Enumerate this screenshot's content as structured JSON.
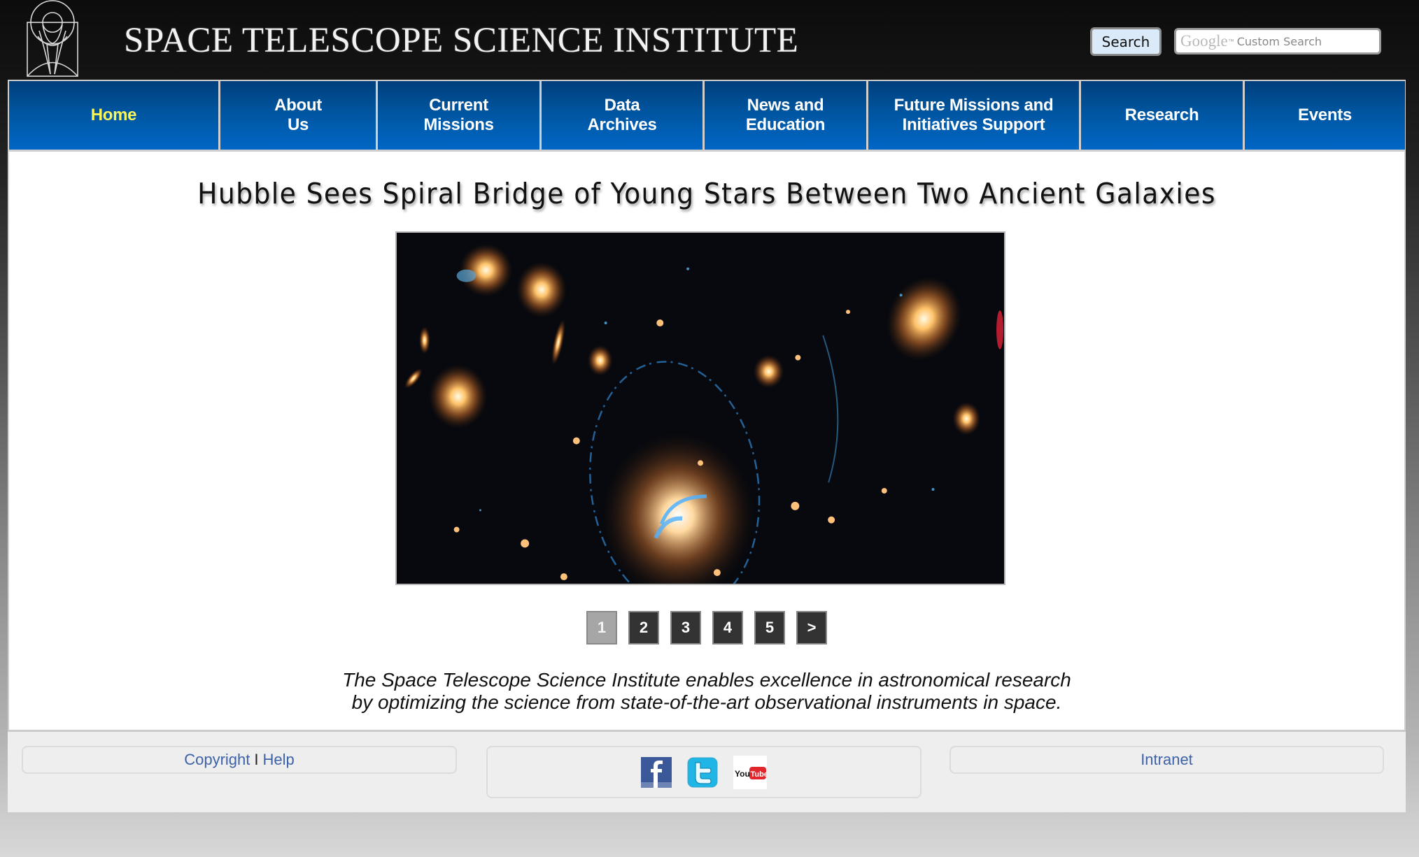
{
  "header": {
    "logo_icon": "stsci-telescope-logo-icon",
    "title": "SPACE TELESCOPE SCIENCE INSTITUTE",
    "search_button_label": "Search",
    "search_input_value": "",
    "search_watermark_brand": "Google",
    "search_watermark_tm": "™",
    "search_watermark_text": "Custom Search"
  },
  "nav": {
    "items": [
      {
        "label": "Home",
        "active": true
      },
      {
        "label": "About\nUs"
      },
      {
        "label": "Current\nMissions"
      },
      {
        "label": "Data\nArchives"
      },
      {
        "label": "News and\nEducation"
      },
      {
        "label": "Future Missions and\nInitiatives Support"
      },
      {
        "label": "Research"
      },
      {
        "label": "Events"
      }
    ],
    "colors": {
      "active_text": "#f7f55b",
      "bg_top": "#003f7c",
      "bg_bottom": "#0067c6"
    }
  },
  "feature": {
    "headline": "Hubble Sees Spiral Bridge of Young Stars Between Two Ancient Galaxies",
    "image_alt": "Hubble image of galaxy cluster with blue spiral bridge of young stars"
  },
  "pager": {
    "pages": [
      "1",
      "2",
      "3",
      "4",
      "5"
    ],
    "current": "1",
    "next_label": ">"
  },
  "tagline": {
    "line1": "The Space Telescope Science Institute enables excellence in astronomical research",
    "line2": "by optimizing the science from state-of-the-art observational instruments in space."
  },
  "footer": {
    "copyright_label": "Copyright",
    "separator": "I",
    "help_label": "Help",
    "intranet_label": "Intranet",
    "social": [
      {
        "name": "facebook-icon",
        "label": "f"
      },
      {
        "name": "twitter-icon",
        "label": "t"
      },
      {
        "name": "youtube-icon",
        "label_you": "You",
        "label_tube": "Tube"
      }
    ],
    "link_color": "#3d62a8"
  }
}
